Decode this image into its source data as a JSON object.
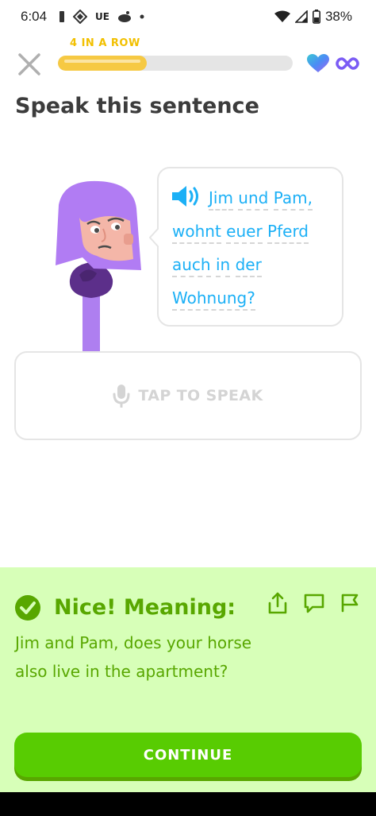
{
  "status_bar": {
    "time": "6:04",
    "carrier_text": "UE",
    "battery": "38%"
  },
  "header": {
    "streak_label": "4 IN A ROW",
    "progress": 0.38,
    "colors": {
      "progress": "#f6c943",
      "streak": "#f2c000"
    }
  },
  "lesson": {
    "title": "Speak this sentence",
    "sentence_lines": [
      [
        "Jim",
        "und",
        "Pam,"
      ],
      [
        "wohnt",
        "euer",
        "Pferd"
      ],
      [
        "auch",
        "in",
        "der"
      ],
      [
        "Wohnung?"
      ]
    ],
    "tap_label": "TAP TO SPEAK"
  },
  "feedback": {
    "title": "Nice! Meaning:",
    "meaning": "Jim and Pam, does your horse also live in the apartment?",
    "continue_label": "CONTINUE",
    "colors": {
      "panel": "#d7ffb8",
      "accent": "#58a700",
      "button": "#58cc02"
    }
  },
  "icons": [
    "close-icon",
    "heart-icon",
    "infinity-icon",
    "speaker-icon",
    "microphone-icon",
    "check-circle-icon",
    "share-icon",
    "comment-icon",
    "flag-icon"
  ]
}
